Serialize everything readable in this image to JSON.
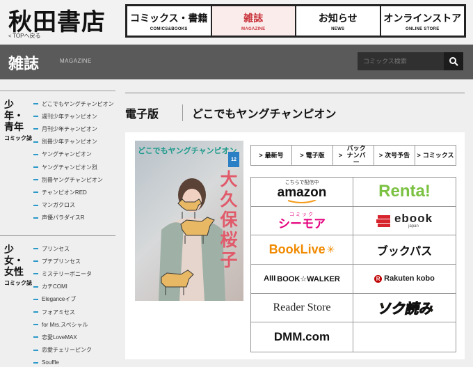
{
  "site": {
    "logo": "秋田書店",
    "back_link": "TOPへ戻る"
  },
  "nav": [
    {
      "jp": "コミックス・書籍",
      "en": "COMICS&BOOKS"
    },
    {
      "jp": "雑誌",
      "en": "MAGAZINE"
    },
    {
      "jp": "お知らせ",
      "en": "NEWS"
    },
    {
      "jp": "オンラインストア",
      "en": "ONLINE STORE"
    }
  ],
  "banner": {
    "title": "雑誌",
    "subtitle": "MAGAZINE",
    "search_placeholder": "コミックス検索"
  },
  "sidebar": {
    "group1": {
      "heading": "少年・青年",
      "sub": "コミック誌",
      "items": [
        "どこでもヤングチャンピオン",
        "週刊少年チャンピオン",
        "月刊少年チャンピオン",
        "別冊少年チャンピオン",
        "ヤングチャンピオン",
        "ヤングチャンピオン烈",
        "別冊ヤングチャンピオン",
        "チャンピオンRED",
        "マンガクロス",
        "声優パラダイスR"
      ]
    },
    "group2": {
      "heading": "少女・女性",
      "sub": "コミック誌",
      "items": [
        "プリンセス",
        "プチプリンセス",
        "ミステリーボニータ",
        "カチCOMI",
        "Eleganceイブ",
        "フォアミセス",
        "for Mrs.スペシャル",
        "恋愛LoveMAX",
        "恋愛チェリーピンク",
        "Souffle"
      ]
    }
  },
  "page": {
    "heading": "電子版",
    "title": "どこでもヤングチャンピオン"
  },
  "cover": {
    "title": "どこでもヤングチャンピオン",
    "issue": "12",
    "vertical_text": "大久保桜子"
  },
  "tabs": [
    "最新号",
    "電子版",
    "バック ナンバー",
    "次号予告",
    "コミックス"
  ],
  "stores": {
    "amazon": {
      "pre": "こちらで配信中",
      "name": "amazon"
    },
    "renta": "Renta!",
    "cmoa": {
      "top": "コミック",
      "name": "シーモア"
    },
    "ebook": {
      "name": "ebook",
      "sub": "japan"
    },
    "booklive": "BookLive",
    "bookpass": "ブックパス",
    "bookwalker": "BOOK☆WALKER",
    "rakuten": "Rakuten kobo",
    "reader": "Reader Store",
    "sokuyomi": "ソク読み",
    "dmm": "DMM.com"
  },
  "colors": {
    "accent_red": "#c8333a",
    "sidebar_bullet": "#2a98c8",
    "banner_bg": "#5a5a5a"
  }
}
